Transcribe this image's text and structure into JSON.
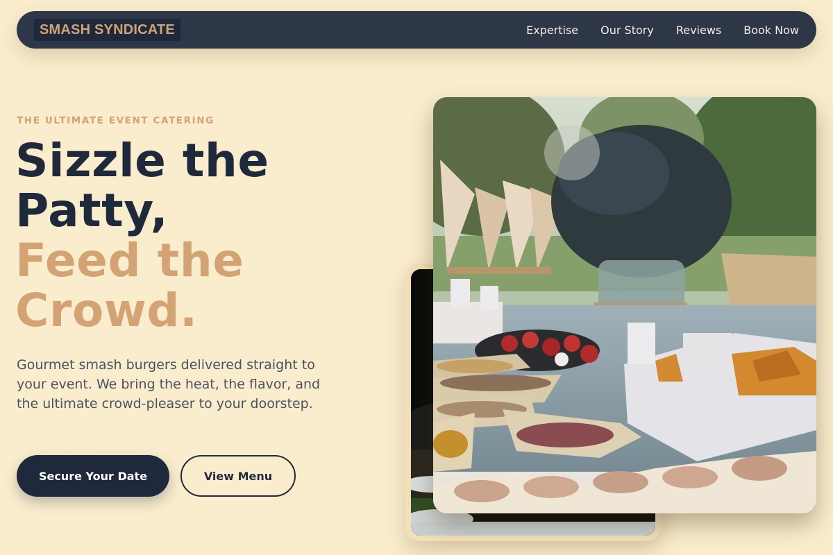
{
  "nav": {
    "brand": "SMASH SYNDICATE",
    "links": [
      {
        "label": "Expertise"
      },
      {
        "label": "Our Story"
      },
      {
        "label": "Reviews"
      },
      {
        "label": "Book Now"
      }
    ]
  },
  "hero": {
    "eyebrow": "THE ULTIMATE EVENT CATERING",
    "headline": {
      "line1": "Sizzle the",
      "line2": "Patty,",
      "line3": "Feed the",
      "line4": "Crowd."
    },
    "description": "Gourmet smash burgers delivered straight to your event. We bring the heat, the flavor, and the ultimate crowd-pleaser to your doorstep.",
    "primary_cta": "Secure Your Date",
    "secondary_cta": "View Menu"
  },
  "colors": {
    "background": "#faedcd",
    "navy": "#1e293b",
    "navbar": "#2d3748",
    "accent": "#d4a373"
  }
}
